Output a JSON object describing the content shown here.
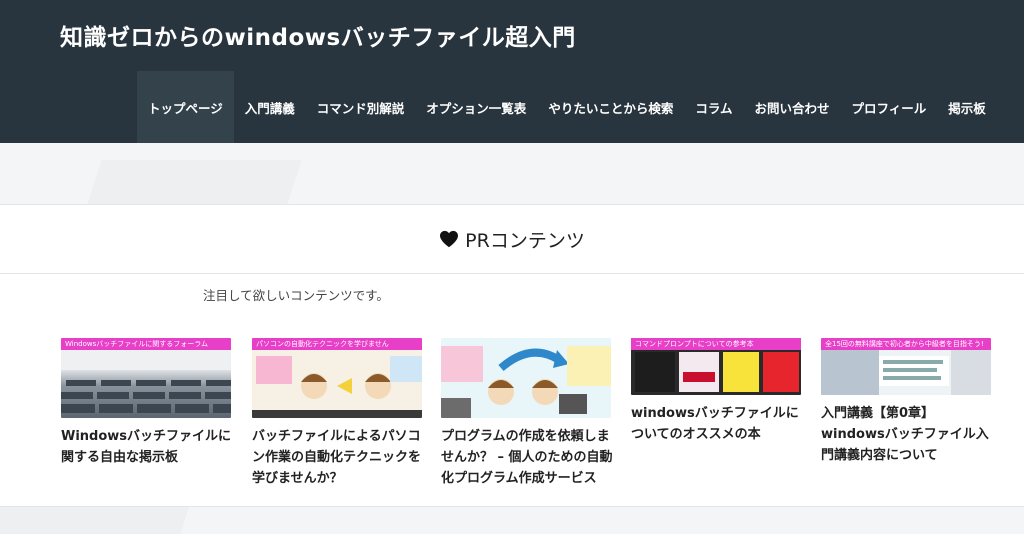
{
  "site": {
    "title": "知識ゼロからのwindowsバッチファイル超入門"
  },
  "nav": {
    "items": [
      {
        "label": "トップページ"
      },
      {
        "label": "入門講義"
      },
      {
        "label": "コマンド別解説"
      },
      {
        "label": "オプション一覧表"
      },
      {
        "label": "やりたいことから検索"
      },
      {
        "label": "コラム"
      },
      {
        "label": "お問い合わせ"
      },
      {
        "label": "プロフィール"
      },
      {
        "label": "掲示板"
      }
    ]
  },
  "pr": {
    "icon": "heart-icon",
    "title": "PRコンテンツ",
    "description": "注目して欲しいコンテンツです。",
    "cards": [
      {
        "title": "Windowsバッチファイルに関する自由な掲示板",
        "banner": "Windowsバッチファイルに関するフォーラム"
      },
      {
        "title": "バッチファイルによるパソコン作業の自動化テクニックを学びませんか？",
        "banner": "パソコンの自動化テクニックを学びません"
      },
      {
        "title": "プログラムの作成を依頼しませんか？ – 個人のための自動化プログラム作成サービス",
        "banner": ""
      },
      {
        "title": "windowsバッチファイルについてのオススメの本",
        "banner": "コマンドプロンプトについての参考本"
      },
      {
        "title": "入門講義【第0章】windowsバッチファイル入門講義内容について",
        "banner": "全15回の無料講座で初心者から中級者を目指そう!"
      }
    ]
  },
  "colors": {
    "header_bg": "#29353e",
    "nav_active": "#34424c",
    "banner_pink": "#e83fc9"
  }
}
